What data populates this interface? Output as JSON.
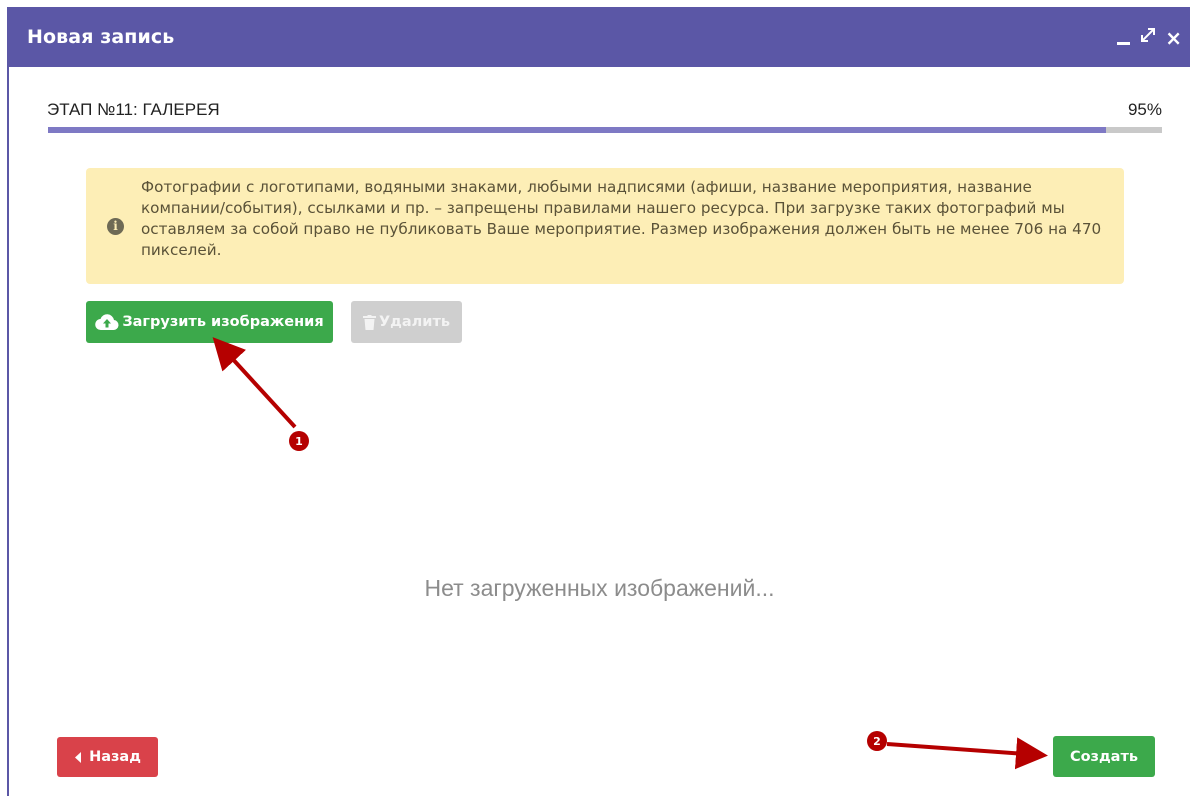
{
  "window": {
    "title": "Новая запись",
    "controls": {
      "minimize": "minimize-icon",
      "maximize": "expand-icon",
      "close": "×"
    }
  },
  "stage": {
    "label": "ЭТАП №11: ГАЛЕРЕЯ",
    "percent_text": "95%",
    "progress": 0.95,
    "progress_color": "#7e79c4"
  },
  "notice": {
    "icon": "info-icon",
    "text": "Фотографии с логотипами, водяными знаками, любыми надписями (афиши, название мероприятия, название компании/события), ссылками и пр. – запрещены правилами нашего ресурса. При загрузке таких фотографий мы оставляем за собой право не публиковать Ваше мероприятие. Размер изображения должен быть не менее 706 на 470 пикселей."
  },
  "toolbar": {
    "upload_label": "Загрузить изображения",
    "upload_icon": "cloud-upload-icon",
    "delete_label": "Удалить",
    "delete_icon": "trash-icon"
  },
  "gallery": {
    "empty_text": "Нет загруженных изображений..."
  },
  "footer": {
    "back_label": "Назад",
    "back_icon": "caret-left-icon",
    "create_label": "Создать"
  },
  "annotations": [
    {
      "number": "1",
      "target": "upload-button"
    },
    {
      "number": "2",
      "target": "create-button"
    }
  ],
  "colors": {
    "header": "#5b57a6",
    "success": "#3ca94b",
    "danger": "#d9424a",
    "warning_bg": "#fdeeb6",
    "annotation": "#b50000"
  }
}
